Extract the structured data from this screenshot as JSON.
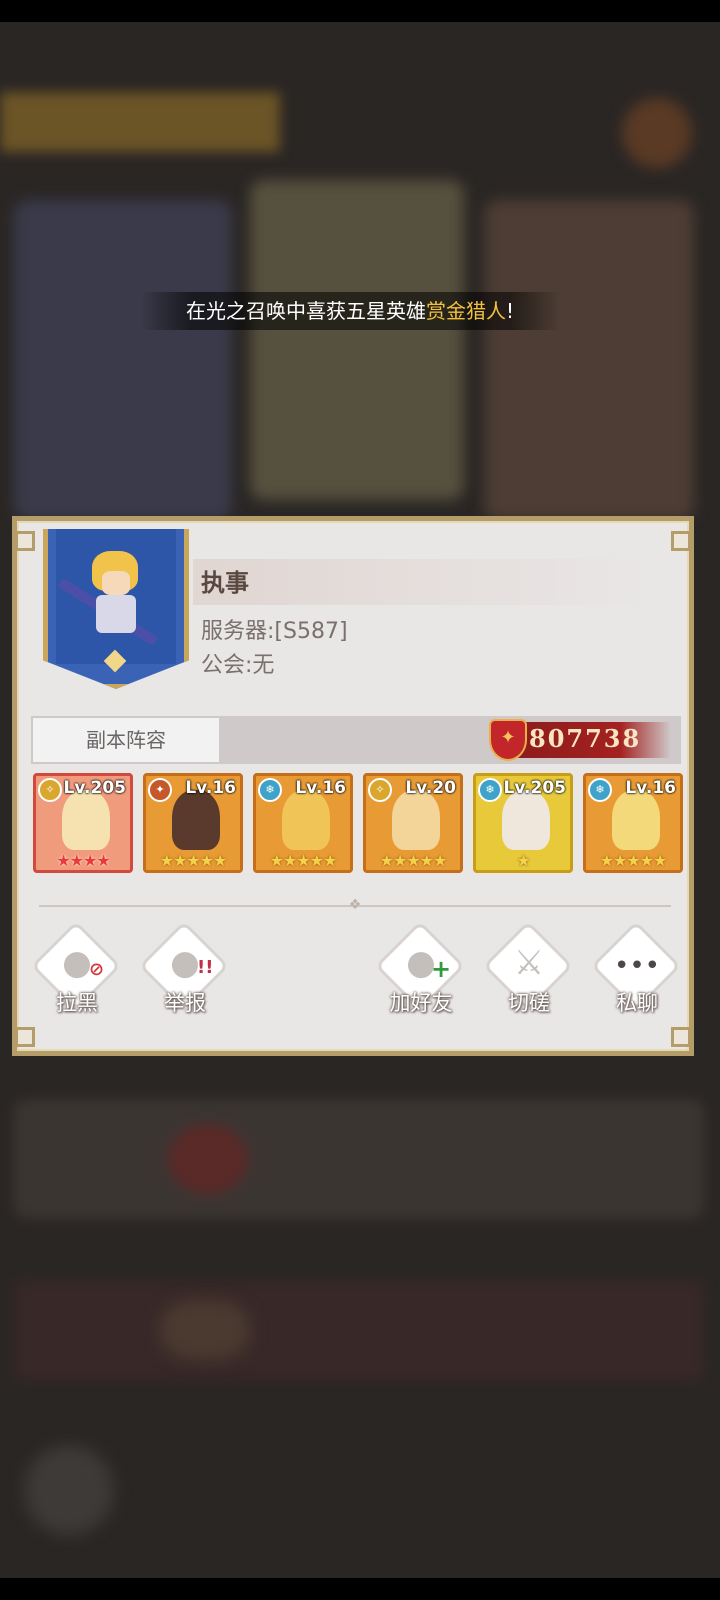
{
  "notice": {
    "prefix": "在光之召唤中喜获五星英雄",
    "hero": "赏金猎人",
    "suffix": "!"
  },
  "profile": {
    "name": "执事",
    "server": "服务器:[S587]",
    "guild": "公会:无"
  },
  "lineup": {
    "tab_label": "副本阵容",
    "power": "807738"
  },
  "heroes": [
    {
      "level": "Lv.205",
      "stars": "★★★★",
      "frame": "red",
      "faction_icon": "light-faction-icon"
    },
    {
      "level": "Lv.16",
      "stars": "★★★★★",
      "frame": "orange",
      "faction_icon": "beast-faction-icon"
    },
    {
      "level": "Lv.16",
      "stars": "★★★★★",
      "frame": "orange",
      "faction_icon": "ice-faction-icon"
    },
    {
      "level": "Lv.20",
      "stars": "★★★★★",
      "frame": "orange",
      "faction_icon": "light-faction-icon"
    },
    {
      "level": "Lv.205",
      "stars": "★",
      "frame": "yellow",
      "faction_icon": "ice-faction-icon"
    },
    {
      "level": "Lv.16",
      "stars": "★★★★★",
      "frame": "orange",
      "faction_icon": "ice-faction-icon"
    }
  ],
  "actions": {
    "block": "拉黑",
    "report": "举报",
    "add_friend": "加好友",
    "spar": "切磋",
    "private_chat": "私聊"
  }
}
